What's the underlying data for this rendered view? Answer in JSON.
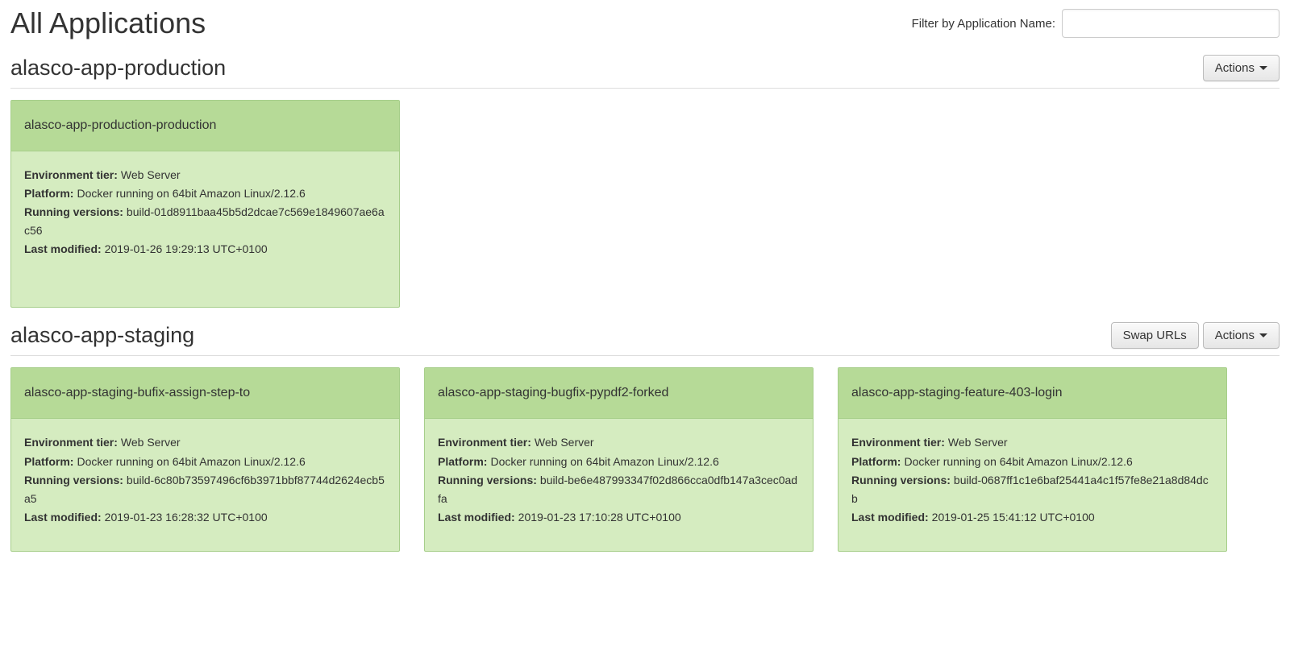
{
  "page": {
    "title": "All Applications",
    "filterLabel": "Filter by Application Name:",
    "filterValue": ""
  },
  "buttons": {
    "actions": "Actions",
    "swapUrls": "Swap URLs"
  },
  "labels": {
    "envTier": "Environment tier:",
    "platform": "Platform:",
    "runningVersions": "Running versions:",
    "lastModified": "Last modified:"
  },
  "applications": [
    {
      "name": "alasco-app-production",
      "showSwap": false,
      "environments": [
        {
          "name": "alasco-app-production-production",
          "tier": "Web Server",
          "platform": "Docker running on 64bit Amazon Linux/2.12.6",
          "runningVersion": "build-01d8911baa45b5d2dcae7c569e1849607ae6ac56",
          "lastModified": "2019-01-26 19:29:13 UTC+0100",
          "tall": true
        }
      ]
    },
    {
      "name": "alasco-app-staging",
      "showSwap": true,
      "environments": [
        {
          "name": "alasco-app-staging-bufix-assign-step-to",
          "tier": "Web Server",
          "platform": "Docker running on 64bit Amazon Linux/2.12.6",
          "runningVersion": "build-6c80b73597496cf6b3971bbf87744d2624ecb5a5",
          "lastModified": "2019-01-23 16:28:32 UTC+0100",
          "tall": false
        },
        {
          "name": "alasco-app-staging-bugfix-pypdf2-forked",
          "tier": "Web Server",
          "platform": "Docker running on 64bit Amazon Linux/2.12.6",
          "runningVersion": "build-be6e487993347f02d866cca0dfb147a3cec0adfa",
          "lastModified": "2019-01-23 17:10:28 UTC+0100",
          "tall": false
        },
        {
          "name": "alasco-app-staging-feature-403-login",
          "tier": "Web Server",
          "platform": "Docker running on 64bit Amazon Linux/2.12.6",
          "runningVersion": "build-0687ff1c1e6baf25441a4c1f57fe8e21a8d84dcb",
          "lastModified": "2019-01-25 15:41:12 UTC+0100",
          "tall": false
        }
      ]
    }
  ]
}
